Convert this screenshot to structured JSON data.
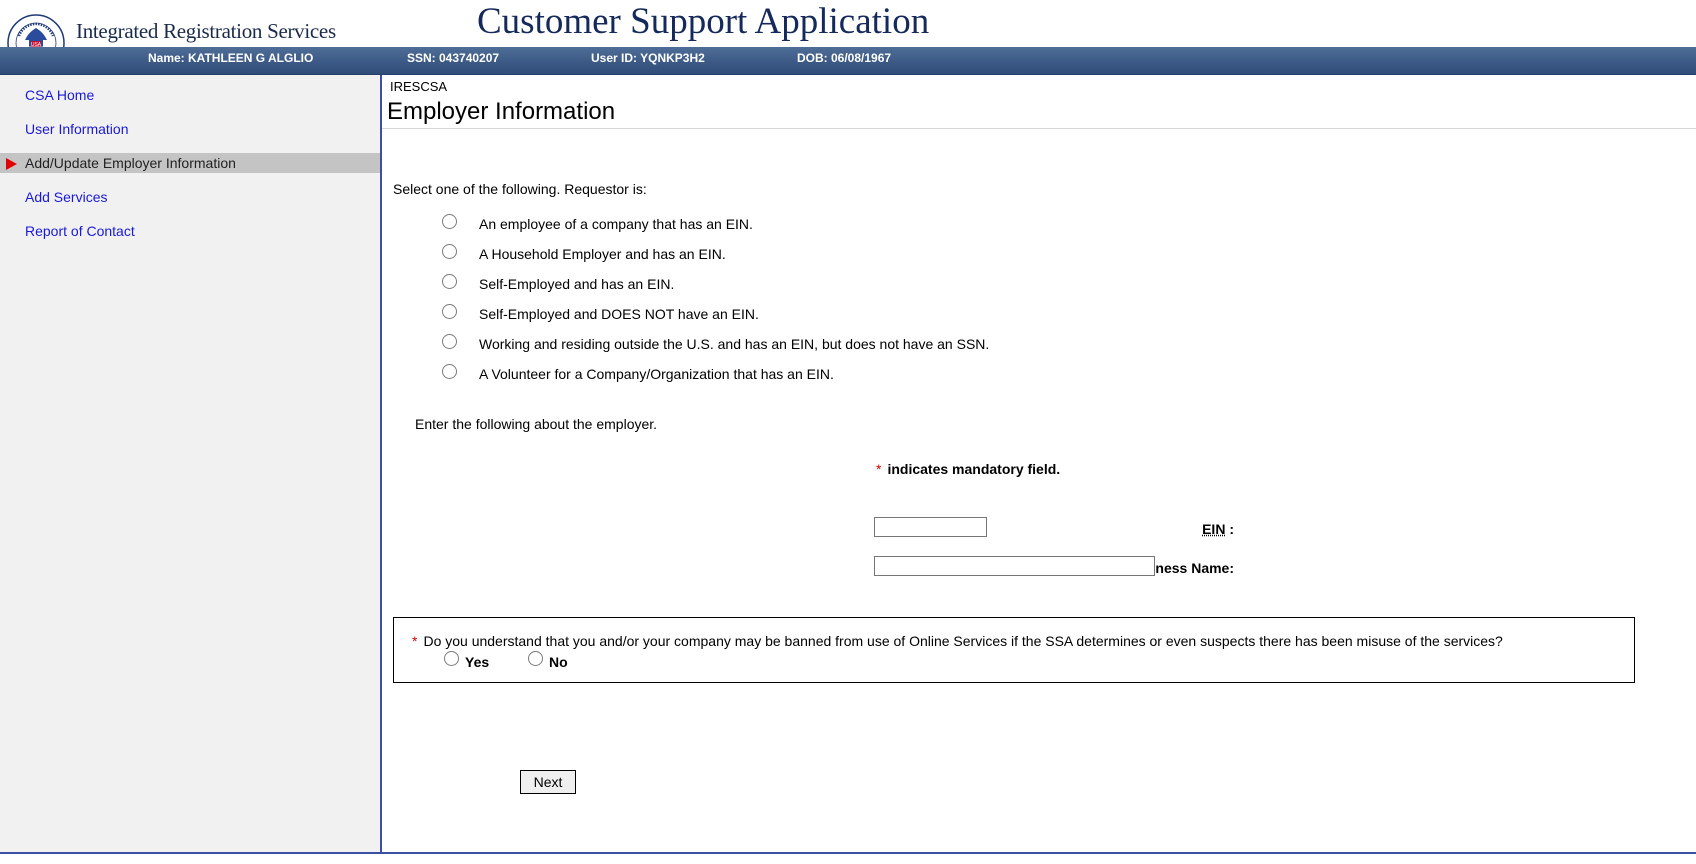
{
  "header": {
    "brand": "Integrated Registration Services",
    "app_title": "Customer Support Application",
    "user_name": "Name: KATHLEEN G ALGLIO",
    "ssn": "SSN: 043740207",
    "user_id": "User ID: YQNKP3H2",
    "dob": "DOB: 06/08/1967"
  },
  "sidebar": {
    "items": [
      {
        "label": "CSA Home"
      },
      {
        "label": "User Information"
      },
      {
        "label": "Add/Update Employer Information",
        "active": true
      },
      {
        "label": "Add Services"
      },
      {
        "label": "Report of Contact"
      }
    ]
  },
  "main": {
    "breadcrumb": "IRESCSA",
    "title": "Employer Information",
    "prompt": "Select one of the following. Requestor is:",
    "options": [
      "An employee of a company that has an EIN.",
      "A Household Employer and has an EIN.",
      "Self-Employed and has an EIN.",
      "Self-Employed and DOES NOT have an EIN.",
      "Working and residing outside the U.S. and has an EIN, but does not have an SSN.",
      "A Volunteer for a Company/Organization that has an EIN."
    ],
    "enter_info": "Enter the following about the employer.",
    "mandatory_star": "*",
    "mandatory_note": "indicates mandatory field.",
    "ein_label": "EIN",
    "ein_colon": ":",
    "ein_value": "",
    "company_label": "Company/Organization Name or Business Name:",
    "company_value": "",
    "question": "Do you understand that you and/or your company may be banned from use of Online Services if the SSA determines or even suspects there has been misuse of the services?",
    "yes_label": "Yes",
    "no_label": "No",
    "next_label": "Next"
  },
  "colors": {
    "userbar": "#3c5a85",
    "link": "#1a1ad6",
    "required": "#d40000",
    "active_arrow": "#e20000",
    "divider": "#3c4fa3"
  }
}
